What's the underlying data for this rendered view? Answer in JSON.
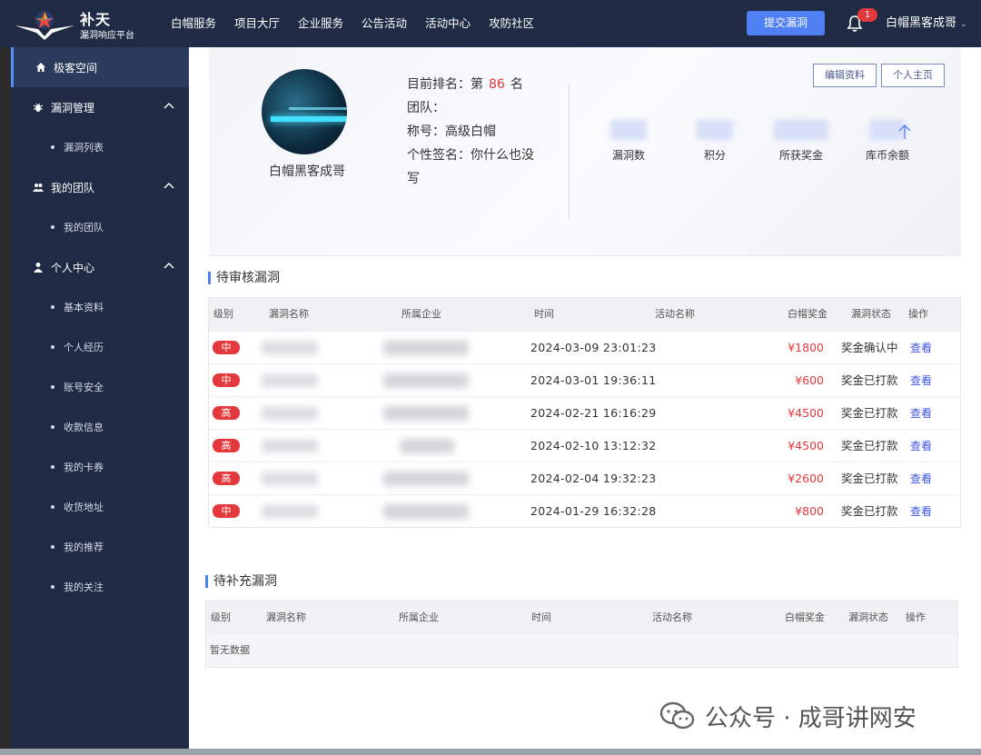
{
  "brand": {
    "name": "补天",
    "subtitle": "漏洞响应平台"
  },
  "nav": {
    "items": [
      "白帽服务",
      "项目大厅",
      "企业服务",
      "公告活动",
      "活动中心",
      "攻防社区"
    ],
    "submit_label": "提交漏洞",
    "notification_count": "1",
    "username": "白帽黑客成哥"
  },
  "sidebar": {
    "home": "极客空间",
    "vuln_mgmt": "漏洞管理",
    "vuln_list": "漏洞列表",
    "my_team": "我的团队",
    "my_team_sub": "我的团队",
    "personal": "个人中心",
    "personal_items": [
      "基本资料",
      "个人经历",
      "账号安全",
      "收款信息",
      "我的卡券",
      "收货地址",
      "我的推荐",
      "我的关注"
    ]
  },
  "profile": {
    "name": "白帽黑客成哥",
    "rank_prefix": "目前排名：第",
    "rank_value": "86",
    "rank_suffix": "名",
    "team_label": "团队：",
    "title_label": "称号：高级白帽",
    "signature_line1": "个性签名：你什么也没",
    "signature_line2": "写",
    "edit_label": "编辑资料",
    "home_label": "个人主页",
    "stats": [
      "漏洞数",
      "积分",
      "所获奖金",
      "库币余额"
    ]
  },
  "pending": {
    "title": "待审核漏洞",
    "headers": [
      "级别",
      "漏洞名称",
      "所属企业",
      "时间",
      "活动名称",
      "白帽奖金",
      "漏洞状态",
      "操作"
    ],
    "rows": [
      {
        "level": "中",
        "time": "2024-03-09 23:01:23",
        "amount": "¥1800",
        "status": "奖金确认中",
        "op": "查看"
      },
      {
        "level": "中",
        "time": "2024-03-01 19:36:11",
        "amount": "¥600",
        "status": "奖金已打款",
        "op": "查看"
      },
      {
        "level": "高",
        "time": "2024-02-21 16:16:29",
        "amount": "¥4500",
        "status": "奖金已打款",
        "op": "查看"
      },
      {
        "level": "高",
        "time": "2024-02-10 13:12:32",
        "amount": "¥4500",
        "status": "奖金已打款",
        "op": "查看"
      },
      {
        "level": "高",
        "time": "2024-02-04 19:32:23",
        "amount": "¥2600",
        "status": "奖金已打款",
        "op": "查看"
      },
      {
        "level": "中",
        "time": "2024-01-29 16:32:28",
        "amount": "¥800",
        "status": "奖金已打款",
        "op": "查看"
      }
    ]
  },
  "supplement": {
    "title": "待补充漏洞",
    "headers": [
      "级别",
      "漏洞名称",
      "所属企业",
      "时间",
      "活动名称",
      "白帽奖金",
      "漏洞状态",
      "操作"
    ],
    "empty": "暂无数据"
  },
  "watermark": {
    "text": "公众号 · 成哥讲网安"
  },
  "colors": {
    "nav_bg": "#1f2a44",
    "accent": "#4e80f3",
    "danger": "#e4393c",
    "link": "#3d56e0"
  }
}
